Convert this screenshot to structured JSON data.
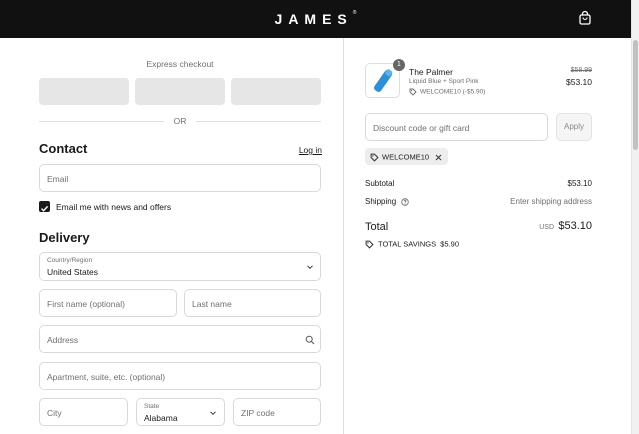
{
  "header": {
    "brand": "JAMES",
    "brand_mark": "®"
  },
  "express": {
    "label": "Express checkout",
    "or_label": "OR"
  },
  "contact": {
    "heading": "Contact",
    "login_link": "Log in",
    "email_placeholder": "Email",
    "newsletter_label": "Email me with news and offers",
    "newsletter_checked": true
  },
  "delivery": {
    "heading": "Delivery",
    "country_label": "Country/Region",
    "country_value": "United States",
    "first_name_placeholder": "First name (optional)",
    "last_name_placeholder": "Last name",
    "address_placeholder": "Address",
    "apartment_placeholder": "Apartment, suite, etc. (optional)",
    "city_placeholder": "City",
    "state_label": "State",
    "state_value": "Alabama",
    "zip_placeholder": "ZIP code"
  },
  "order": {
    "item": {
      "quantity": "1",
      "name": "The Palmer",
      "variant": "Liquid Blue + Sport Pink",
      "discount": "WELCOME10 (-$5.90)",
      "original_price": "$58.99",
      "price": "$53.10"
    },
    "discount_placeholder": "Discount code or gift card",
    "apply_label": "Apply",
    "applied_code": "WELCOME10",
    "subtotal_label": "Subtotal",
    "subtotal_value": "$53.10",
    "shipping_label": "Shipping",
    "shipping_value": "Enter shipping address",
    "total_label": "Total",
    "total_currency": "USD",
    "total_value": "$53.10",
    "savings_label": "TOTAL SAVINGS",
    "savings_value": "$5.90"
  },
  "colors": {
    "header_bg": "#111111",
    "product_blue": "#2d8fd6"
  }
}
